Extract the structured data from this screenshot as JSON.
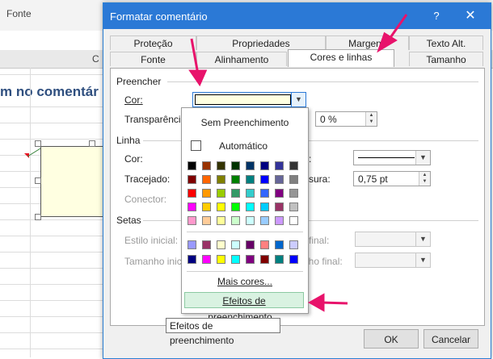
{
  "excel": {
    "ribbon_group": "Fonte",
    "column_letter": "C",
    "headline": "m no comentár"
  },
  "dialog": {
    "title": "Formatar comentário",
    "help": "?",
    "close": "✕",
    "tabs_row1": [
      "Proteção",
      "Propriedades",
      "Margens",
      "Texto Alt."
    ],
    "tabs_row2": [
      "Fonte",
      "Alinhamento",
      "Cores e linhas",
      "Tamanho"
    ],
    "active_tab": "Cores e linhas",
    "fill": {
      "section": "Preencher",
      "color_label": "Cor:",
      "color_value_hex": "#ffffe1",
      "transparency_label": "Transparência",
      "transparency_value": "0 %"
    },
    "line": {
      "section": "Linha",
      "color_label": "Cor:",
      "dashed_label": "Tracejado:",
      "connector_label": "Conector:",
      "style_label_suffix": ":",
      "weight_label_suffix": "sura:",
      "weight_value": "0,75 pt"
    },
    "arrows": {
      "section": "Setas",
      "start_style_label": "Estilo inicial:",
      "start_size_label": "Tamanho inicial",
      "end_style_label": "final:",
      "end_size_label": "nho final:"
    },
    "ok": "OK",
    "cancel": "Cancelar"
  },
  "color_dropdown": {
    "no_fill": "Sem Preenchimento",
    "automatic": "Automático",
    "more_colors": "Mais cores...",
    "fill_effects": "Efeitos de preenchimento...",
    "tooltip": "Efeitos de preenchimento",
    "palette_rows": [
      [
        "#000000",
        "#993300",
        "#333300",
        "#003300",
        "#003366",
        "#000080",
        "#333399",
        "#333333"
      ],
      [
        "#800000",
        "#ff6600",
        "#808000",
        "#008000",
        "#008080",
        "#0000ff",
        "#666699",
        "#808080"
      ],
      [
        "#ff0000",
        "#ff9900",
        "#99cc00",
        "#339966",
        "#33cccc",
        "#3366ff",
        "#800080",
        "#969696"
      ],
      [
        "#ff00ff",
        "#ffcc00",
        "#ffff00",
        "#00ff00",
        "#00ffff",
        "#00ccff",
        "#993366",
        "#c0c0c0"
      ],
      [
        "#ff99cc",
        "#ffcc99",
        "#ffff99",
        "#ccffcc",
        "#ccffff",
        "#99ccff",
        "#cc99ff",
        "#ffffff"
      ]
    ],
    "extra_rows": [
      [
        "#9999ff",
        "#993366",
        "#ffffcc",
        "#ccffff",
        "#660066",
        "#ff8080",
        "#0066cc",
        "#ccccff"
      ],
      [
        "#000080",
        "#ff00ff",
        "#ffff00",
        "#00ffff",
        "#800080",
        "#800000",
        "#008080",
        "#0000ff"
      ]
    ]
  },
  "annotation_color": "#e8136b"
}
